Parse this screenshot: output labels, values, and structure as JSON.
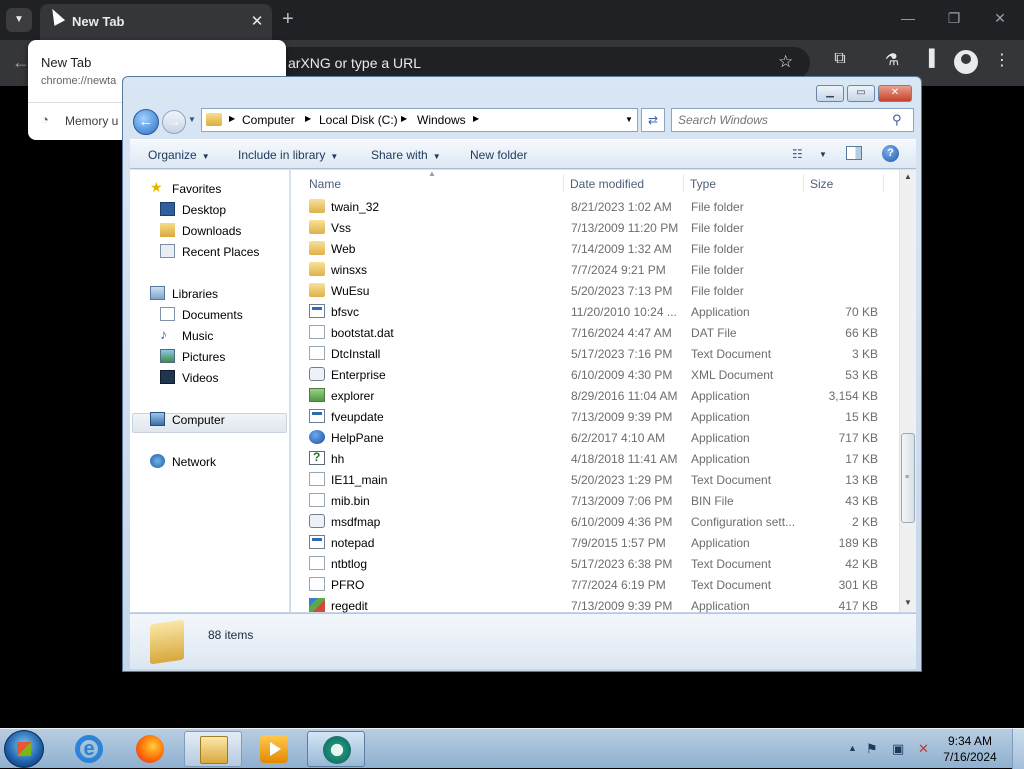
{
  "chrome": {
    "tab_title": "New Tab",
    "omnibox_text": "arXNG or type a URL",
    "hover_card": {
      "title": "New Tab",
      "url": "chrome://newta",
      "memory": "Memory u"
    }
  },
  "explorer": {
    "breadcrumb": [
      "Computer",
      "Local Disk (C:)",
      "Windows"
    ],
    "search_placeholder": "Search Windows",
    "commands": {
      "organize": "Organize",
      "include_in_library": "Include in library",
      "share_with": "Share with",
      "new_folder": "New folder"
    },
    "nav": {
      "favorites": "Favorites",
      "desktop": "Desktop",
      "downloads": "Downloads",
      "recent_places": "Recent Places",
      "libraries": "Libraries",
      "documents": "Documents",
      "music": "Music",
      "pictures": "Pictures",
      "videos": "Videos",
      "computer": "Computer",
      "network": "Network"
    },
    "columns": {
      "name": "Name",
      "date": "Date modified",
      "type": "Type",
      "size": "Size"
    },
    "files": [
      {
        "name": "twain_32",
        "date": "8/21/2023 1:02 AM",
        "type": "File folder",
        "size": "",
        "icon": "folder"
      },
      {
        "name": "Vss",
        "date": "7/13/2009 11:20 PM",
        "type": "File folder",
        "size": "",
        "icon": "folder"
      },
      {
        "name": "Web",
        "date": "7/14/2009 1:32 AM",
        "type": "File folder",
        "size": "",
        "icon": "folder"
      },
      {
        "name": "winsxs",
        "date": "7/7/2024 9:21 PM",
        "type": "File folder",
        "size": "",
        "icon": "folder"
      },
      {
        "name": "WuEsu",
        "date": "5/20/2023 7:13 PM",
        "type": "File folder",
        "size": "",
        "icon": "folder"
      },
      {
        "name": "bfsvc",
        "date": "11/20/2010 10:24 ...",
        "type": "Application",
        "size": "70 KB",
        "icon": "app"
      },
      {
        "name": "bootstat.dat",
        "date": "7/16/2024 4:47 AM",
        "type": "DAT File",
        "size": "66 KB",
        "icon": "doc"
      },
      {
        "name": "DtcInstall",
        "date": "5/17/2023 7:16 PM",
        "type": "Text Document",
        "size": "3 KB",
        "icon": "doc"
      },
      {
        "name": "Enterprise",
        "date": "6/10/2009 4:30 PM",
        "type": "XML Document",
        "size": "53 KB",
        "icon": "gear"
      },
      {
        "name": "explorer",
        "date": "8/29/2016 11:04 AM",
        "type": "Application",
        "size": "3,154 KB",
        "icon": "explorer"
      },
      {
        "name": "fveupdate",
        "date": "7/13/2009 9:39 PM",
        "type": "Application",
        "size": "15 KB",
        "icon": "app"
      },
      {
        "name": "HelpPane",
        "date": "6/2/2017 4:10 AM",
        "type": "Application",
        "size": "717 KB",
        "icon": "help"
      },
      {
        "name": "hh",
        "date": "4/18/2018 11:41 AM",
        "type": "Application",
        "size": "17 KB",
        "icon": "hh"
      },
      {
        "name": "IE11_main",
        "date": "5/20/2023 1:29 PM",
        "type": "Text Document",
        "size": "13 KB",
        "icon": "doc"
      },
      {
        "name": "mib.bin",
        "date": "7/13/2009 7:06 PM",
        "type": "BIN File",
        "size": "43 KB",
        "icon": "doc"
      },
      {
        "name": "msdfmap",
        "date": "6/10/2009 4:36 PM",
        "type": "Configuration sett...",
        "size": "2 KB",
        "icon": "gear"
      },
      {
        "name": "notepad",
        "date": "7/9/2015 1:57 PM",
        "type": "Application",
        "size": "189 KB",
        "icon": "app"
      },
      {
        "name": "ntbtlog",
        "date": "5/17/2023 6:38 PM",
        "type": "Text Document",
        "size": "42 KB",
        "icon": "doc"
      },
      {
        "name": "PFRO",
        "date": "7/7/2024 6:19 PM",
        "type": "Text Document",
        "size": "301 KB",
        "icon": "doc"
      },
      {
        "name": "regedit",
        "date": "7/13/2009 9:39 PM",
        "type": "Application",
        "size": "417 KB",
        "icon": "regedit"
      }
    ],
    "item_count": "88 items"
  },
  "taskbar": {
    "time": "9:34 AM",
    "date": "7/16/2024"
  }
}
